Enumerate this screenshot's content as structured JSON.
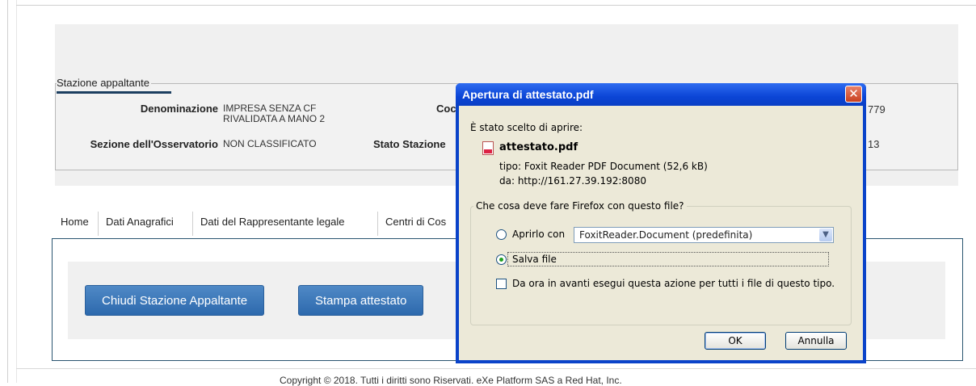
{
  "stazione": {
    "legend": "Stazione appaltante",
    "denominazione_label": "Denominazione",
    "denominazione_value_line1": "IMPRESA SENZA CF",
    "denominazione_value_line2": "RIVALIDATA A MANO 2",
    "codice_label_partial": "Coc",
    "codice_value_partial": "779",
    "sezione_label": "Sezione dell'Osservatorio",
    "sezione_value": "NON CLASSIFICATO",
    "stato_label": "Stato Stazione",
    "stato_value_partial": "13"
  },
  "tabs": [
    {
      "label": "Home"
    },
    {
      "label": "Dati Anagrafici"
    },
    {
      "label": "Dati del Rappresentante legale"
    },
    {
      "label": "Centri di Cos"
    }
  ],
  "actions": {
    "chiudi_label": "Chiudi Stazione Appaltante",
    "stampa_label": "Stampa attestato"
  },
  "footer": {
    "text": "Copyright © 2018. Tutti i diritti sono Riservati. eXe Platform SAS a Red Hat, Inc."
  },
  "dialog": {
    "title": "Apertura di attestato.pdf",
    "close_symbol": "✕",
    "intro": "È stato scelto di aprire:",
    "filename": "attestato.pdf",
    "tipo": "tipo:  Foxit Reader PDF Document (52,6 kB)",
    "da": "da:  http://161.27.39.192:8080",
    "question": "Che cosa deve fare Firefox con questo file?",
    "open_with_label": "Aprirlo con",
    "open_with_app": "FoxitReader.Document (predefinita)",
    "save_label": "Salva file",
    "remember_label": "Da ora in avanti esegui questa azione per tutti i file di questo tipo.",
    "ok_label": "OK",
    "cancel_label": "Annulla",
    "selected_option": "save",
    "remember_checked": false
  }
}
